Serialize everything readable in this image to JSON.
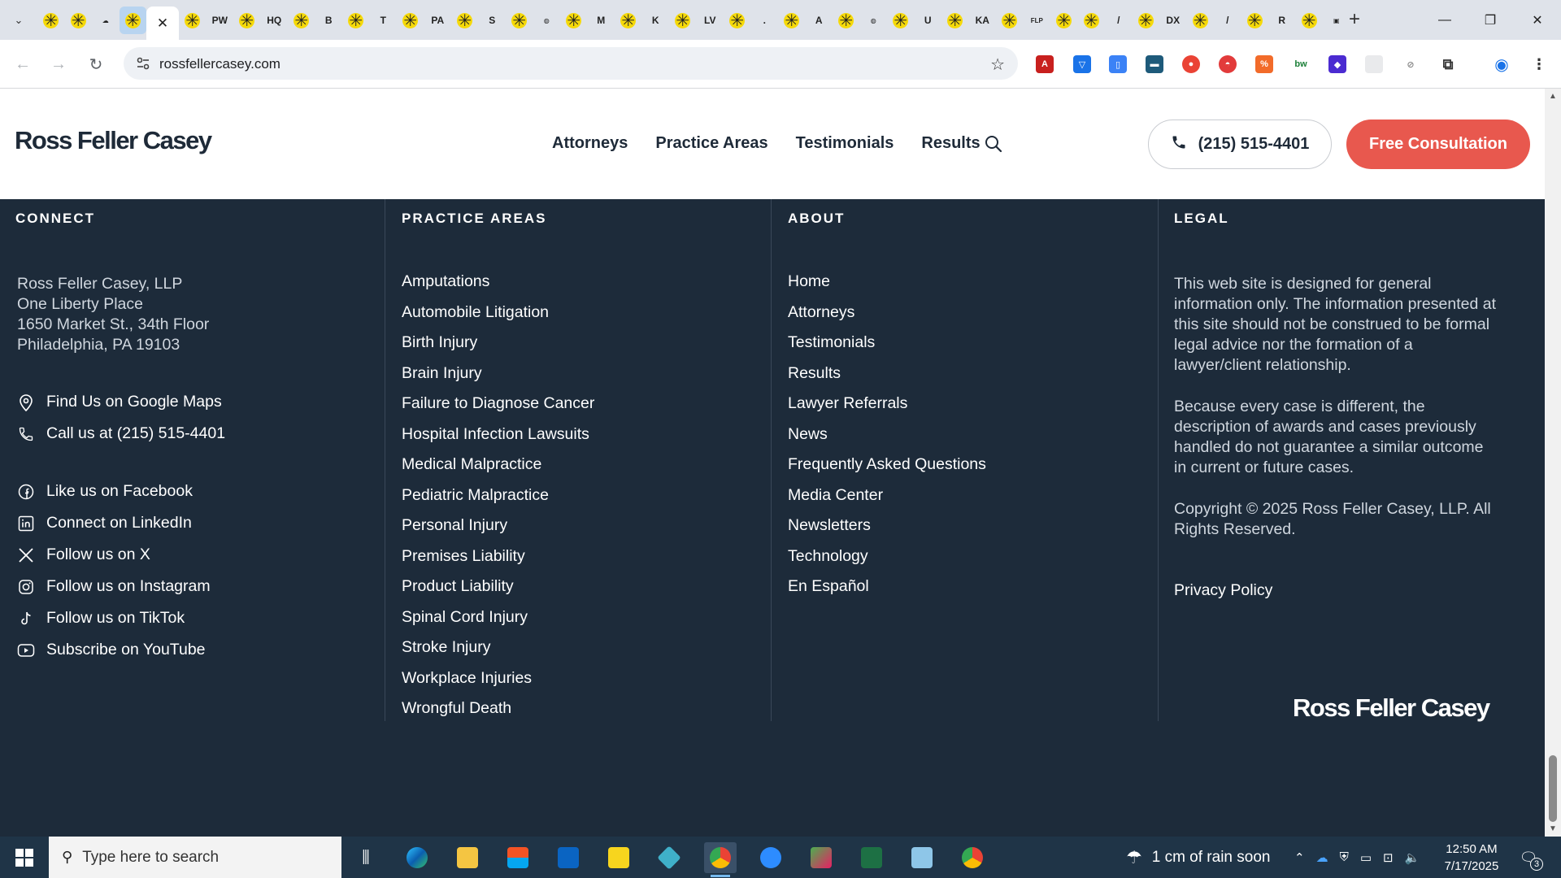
{
  "browser": {
    "url": "rossfellercasey.com",
    "tab_search_icon": "chevron-down-icon",
    "tab_count_visible": 47
  },
  "header": {
    "logo": "Ross Feller Casey",
    "nav": [
      "Attorneys",
      "Practice Areas",
      "Testimonials",
      "Results"
    ],
    "phone_label": "(215) 515-4401",
    "cta_label": "Free Consultation"
  },
  "footer": {
    "connect": {
      "title": "CONNECT",
      "address": [
        "Ross Feller Casey, LLP",
        "One Liberty Place",
        "1650 Market St., 34th Floor",
        "Philadelphia, PA 19103"
      ],
      "contact": [
        {
          "label": "Find Us on Google Maps",
          "icon": "map-pin-icon"
        },
        {
          "label": "Call us at (215) 515-4401",
          "icon": "phone-icon"
        }
      ],
      "social": [
        {
          "label": "Like us on Facebook",
          "icon": "facebook-icon"
        },
        {
          "label": "Connect on LinkedIn",
          "icon": "linkedin-icon"
        },
        {
          "label": "Follow us on X",
          "icon": "x-icon"
        },
        {
          "label": "Follow us on Instagram",
          "icon": "instagram-icon"
        },
        {
          "label": "Follow us on TikTok",
          "icon": "tiktok-icon"
        },
        {
          "label": "Subscribe on YouTube",
          "icon": "youtube-icon"
        }
      ]
    },
    "practice": {
      "title": "PRACTICE AREAS",
      "items": [
        "Amputations",
        "Automobile Litigation",
        "Birth Injury",
        "Brain Injury",
        "Failure to Diagnose Cancer",
        "Hospital Infection Lawsuits",
        "Medical Malpractice",
        "Pediatric Malpractice",
        "Personal Injury",
        "Premises Liability",
        "Product Liability",
        "Spinal Cord Injury",
        "Stroke Injury",
        "Workplace Injuries",
        "Wrongful Death"
      ]
    },
    "about": {
      "title": "ABOUT",
      "items": [
        "Home",
        "Attorneys",
        "Testimonials",
        "Results",
        "Lawyer Referrals",
        "News",
        "Frequently Asked Questions",
        "Media Center",
        "Newsletters",
        "Technology",
        "En Español"
      ]
    },
    "legal": {
      "title": "LEGAL",
      "p1": "This web site is designed for general information only. The information presented at this site should not be construed to be formal legal advice nor the formation of a lawyer/client relationship.",
      "p2": "Because every case is different, the description of awards and cases previously handled do not guarantee a similar outcome in current or future cases.",
      "p3": "Copyright © 2025 Ross Feller Casey, LLP. All Rights Reserved.",
      "privacy": "Privacy Policy"
    },
    "logo": "Ross Feller Casey"
  },
  "taskbar": {
    "search_placeholder": "Type here to search",
    "weather": "1 cm of rain soon",
    "time": "12:50 AM",
    "date": "7/17/2025",
    "notification_count": "3"
  },
  "colors": {
    "footer_bg": "#1d2b3a",
    "cta": "#e8584e",
    "brand_text": "#1e2a38"
  }
}
